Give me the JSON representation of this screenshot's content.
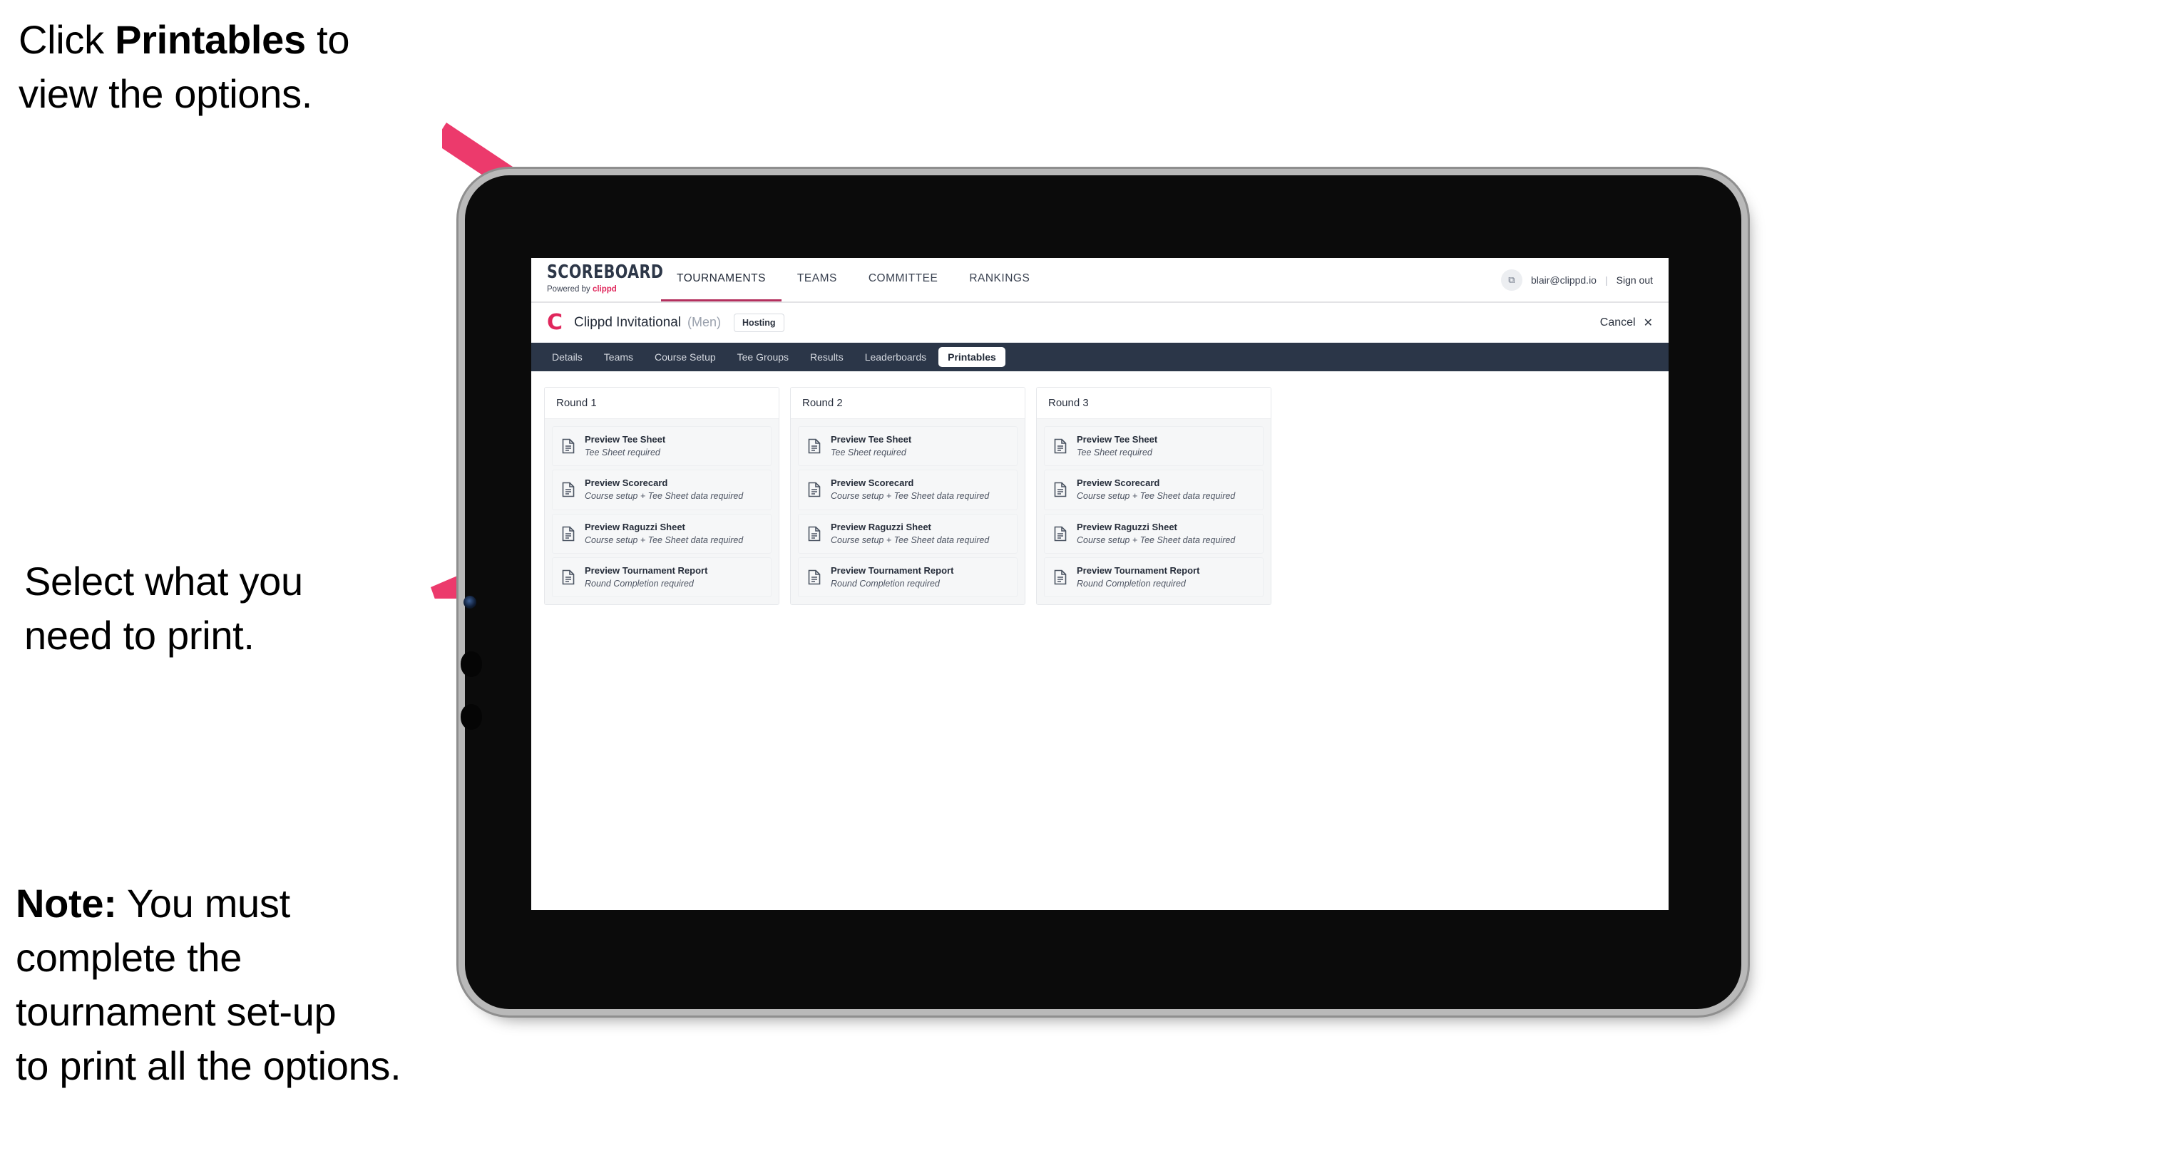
{
  "annotations": {
    "top": {
      "prefix": "Click ",
      "bold": "Printables",
      "suffix": " to\nview the options."
    },
    "middle": "Select what you\n need to print.",
    "note": {
      "bold": "Note:",
      "rest": " You must\ncomplete the\ntournament set-up\nto print all the options."
    }
  },
  "colors": {
    "arrow_pink": "#ec3a6c",
    "brand_pink": "#e0275c",
    "active_tab_underline": "#b4305e",
    "subnav_bg": "#2b3648",
    "card_body_bg": "#f5f6f7"
  },
  "app": {
    "brand": {
      "wordmark": "SCOREBOARD",
      "powered_prefix": "Powered by ",
      "powered_brand": "clippd"
    },
    "nav": [
      {
        "label": "TOURNAMENTS",
        "active": true
      },
      {
        "label": "TEAMS",
        "active": false
      },
      {
        "label": "COMMITTEE",
        "active": false
      },
      {
        "label": "RANKINGS",
        "active": false
      }
    ],
    "account": {
      "avatar_glyph": "⧉",
      "email": "blair@clippd.io",
      "divider": "|",
      "sign_out": "Sign out"
    },
    "title_bar": {
      "logo_letter": "C",
      "tournament_name": "Clippd Invitational",
      "gender": "(Men)",
      "hosting_badge": "Hosting",
      "cancel_label": "Cancel",
      "cancel_glyph": "✕"
    },
    "subnav": [
      {
        "label": "Details",
        "active": false
      },
      {
        "label": "Teams",
        "active": false
      },
      {
        "label": "Course Setup",
        "active": false
      },
      {
        "label": "Tee Groups",
        "active": false
      },
      {
        "label": "Results",
        "active": false
      },
      {
        "label": "Leaderboards",
        "active": false
      },
      {
        "label": "Printables",
        "active": true
      }
    ],
    "rounds": [
      {
        "title": "Round 1",
        "items": [
          {
            "title": "Preview Tee Sheet",
            "sub": "Tee Sheet required"
          },
          {
            "title": "Preview Scorecard",
            "sub": "Course setup + Tee Sheet data required"
          },
          {
            "title": "Preview Raguzzi Sheet",
            "sub": "Course setup + Tee Sheet data required"
          },
          {
            "title": "Preview Tournament Report",
            "sub": "Round Completion required"
          }
        ]
      },
      {
        "title": "Round 2",
        "items": [
          {
            "title": "Preview Tee Sheet",
            "sub": "Tee Sheet required"
          },
          {
            "title": "Preview Scorecard",
            "sub": "Course setup + Tee Sheet data required"
          },
          {
            "title": "Preview Raguzzi Sheet",
            "sub": "Course setup + Tee Sheet data required"
          },
          {
            "title": "Preview Tournament Report",
            "sub": "Round Completion required"
          }
        ]
      },
      {
        "title": "Round 3",
        "items": [
          {
            "title": "Preview Tee Sheet",
            "sub": "Tee Sheet required"
          },
          {
            "title": "Preview Scorecard",
            "sub": "Course setup + Tee Sheet data required"
          },
          {
            "title": "Preview Raguzzi Sheet",
            "sub": "Course setup + Tee Sheet data required"
          },
          {
            "title": "Preview Tournament Report",
            "sub": "Round Completion required"
          }
        ]
      }
    ]
  }
}
